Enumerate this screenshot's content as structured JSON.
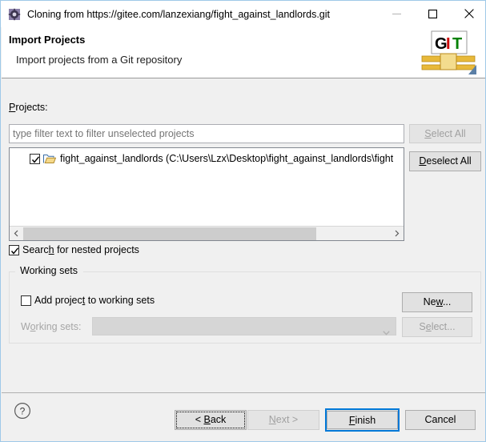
{
  "window": {
    "title": "Cloning from https://gitee.com/lanzexiang/fight_against_landlords.git",
    "icon": "eclipse-gear-icon",
    "controls": {
      "minimize": "minimize-icon",
      "maximize": "maximize-icon",
      "close": "close-icon"
    },
    "border_color": "#9fc9e8"
  },
  "header": {
    "title": "Import Projects",
    "subtitle": "Import projects from a Git repository",
    "banner_icon": "git-banner-icon",
    "banner_text": {
      "g": "G",
      "i": "I",
      "t": "T"
    },
    "banner_colors": {
      "g": "#000000",
      "i": "#cc0000",
      "t": "#008000",
      "bar": "#e8b93a"
    }
  },
  "projects": {
    "label": "Projects:",
    "label_mnemonic": "P",
    "filter": {
      "value": "",
      "placeholder": "type filter text to filter unselected projects"
    },
    "select_all_label": "Select All",
    "select_all_mnemonic": "S",
    "select_all_enabled": false,
    "deselect_all_label": "Deselect All",
    "deselect_all_mnemonic": "D",
    "deselect_all_enabled": true,
    "items": [
      {
        "checked": true,
        "icon": "folder-icon",
        "label": "fight_against_landlords (C:\\Users\\Lzx\\Desktop\\fight_against_landlords\\fight"
      }
    ],
    "hscroll": {
      "left_arrow": "chevron-left-icon",
      "right_arrow": "chevron-right-icon",
      "thumb_percent": 80
    }
  },
  "nested": {
    "label_before": "Searc",
    "label_mnemonic": "h",
    "label_after": " for nested projects",
    "full_label": "Search for nested projects",
    "checked": true
  },
  "working_sets": {
    "group_title": "Working sets",
    "add_checkbox": {
      "label_before": "Add projec",
      "mnemonic": "t",
      "label_after": " to working sets",
      "full_label": "Add project to working sets",
      "checked": false
    },
    "combo_label_before": "W",
    "combo_label_mnemonic": "o",
    "combo_label_after": "rking sets:",
    "combo_label_full": "Working sets:",
    "combo_value": "",
    "combo_enabled": false,
    "combo_chevron": "chevron-down-icon",
    "new_label": "New...",
    "new_mnemonic": "w",
    "new_enabled": true,
    "select_label": "Select...",
    "select_mnemonic": "e",
    "select_enabled": false
  },
  "footer": {
    "help_icon": "help-question-icon",
    "back_label": "< Back",
    "back_mnemonic": "B",
    "back_enabled": true,
    "back_focused": true,
    "next_label": "Next >",
    "next_mnemonic": "N",
    "next_enabled": false,
    "finish_label": "Finish",
    "finish_mnemonic": "F",
    "finish_enabled": true,
    "finish_default": true,
    "finish_border_color": "#0078d7",
    "cancel_label": "Cancel",
    "cancel_enabled": true
  }
}
